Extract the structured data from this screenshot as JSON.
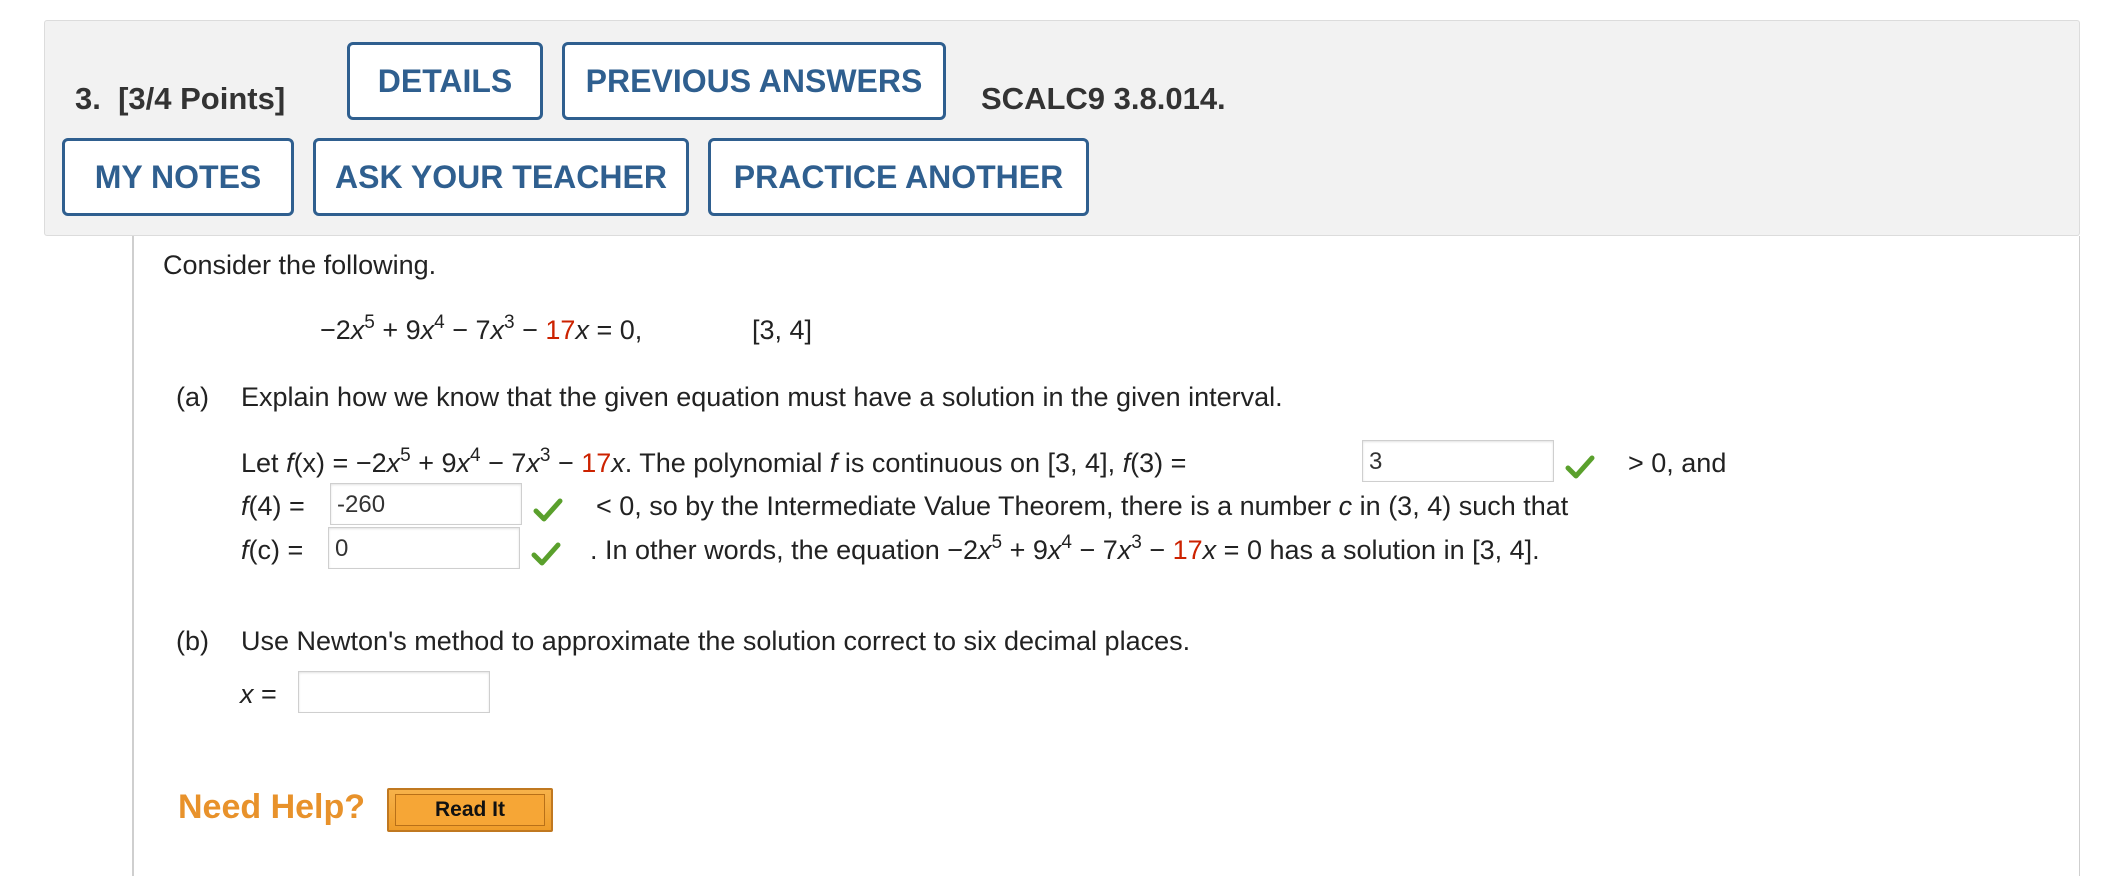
{
  "header": {
    "question_number": "3.",
    "points": "[3/4 Points]",
    "buttons": {
      "details": "DETAILS",
      "previous_answers": "PREVIOUS ANSWERS",
      "my_notes": "MY NOTES",
      "ask_teacher": "ASK YOUR TEACHER",
      "practice_another": "PRACTICE ANOTHER"
    },
    "problem_code": "SCALC9 3.8.014."
  },
  "problem": {
    "intro": "Consider the following.",
    "equation": {
      "lhs_start": "−2",
      "var": "x",
      "exp5": "5",
      "plus9": " + 9",
      "exp4": "4",
      "minus7": " − 7",
      "exp3": "3",
      "minus": " − ",
      "coef": "17",
      "tail": " = 0,",
      "interval": "[3, 4]"
    },
    "part_a": {
      "label": "(a)",
      "question": "Explain how we know that the given equation must have a solution in the given interval.",
      "line1_let": "Let ",
      "line1_fx": "f",
      "line1_mid": "(x) = −2",
      "line1_text": ". The polynomial ",
      "line1_text2": " is continuous on [3, 4], ",
      "line1_f3": "(3) = ",
      "line1_after": "> 0, and",
      "line2_f4": "(4) = ",
      "line2_after": "< 0, so by the Intermediate Value Theorem, there is a number ",
      "line2_c": "c",
      "line2_end": " in (3, 4) such that",
      "line3_fc": "(c) = ",
      "line3_after": ". In other words, the equation −2",
      "line3_end": " = 0 has a solution in [3, 4].",
      "answers": {
        "f3": "3",
        "f4": "-260",
        "fc": "0"
      }
    },
    "part_b": {
      "label": "(b)",
      "question": "Use Newton's method to approximate the solution correct to six decimal places.",
      "x_label": "x",
      "eq": " =",
      "answer": ""
    }
  },
  "help": {
    "label": "Need Help?",
    "read_it": "Read It"
  },
  "colors": {
    "button_blue": "#2f5f8f",
    "red": "#cc2200",
    "check_green": "#5aa02c",
    "help_orange": "#e8922b"
  },
  "icons": [
    "check-icon"
  ]
}
